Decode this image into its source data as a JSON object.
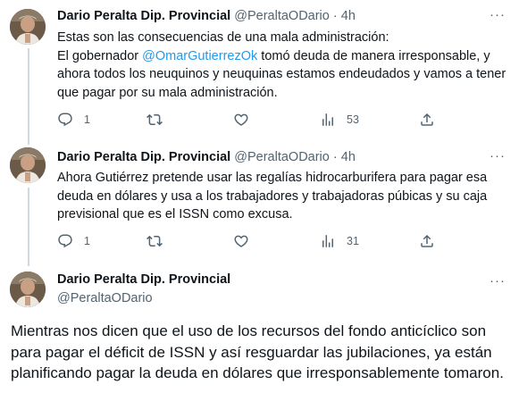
{
  "tweets": [
    {
      "author_name": "Dario Peralta Dip. Provincial",
      "author_handle": "@PeraltaODario",
      "separator": "·",
      "time": "4h",
      "text_line1": "Estas son las consecuencias de una mala administración:",
      "text_pre_mention": "El gobernador ",
      "mention": "@OmarGutierrezOk",
      "text_post_mention": " tomó deuda de manera irresponsable, y ahora todos los neuquinos y neuquinas estamos endeudados y vamos a tener que pagar por su mala administración.",
      "replies": "1",
      "retweets": "",
      "likes": "",
      "views": "53"
    },
    {
      "author_name": "Dario Peralta Dip. Provincial",
      "author_handle": "@PeraltaODario",
      "separator": "·",
      "time": "4h",
      "text": "Ahora Gutiérrez pretende usar las regalías hidrocarburifera para pagar esa deuda en dólares y usa a los trabajadores y trabajadoras púbicas y su caja previsional que es el ISSN como excusa.",
      "replies": "1",
      "retweets": "",
      "likes": "",
      "views": "31"
    }
  ],
  "main_tweet": {
    "author_name": "Dario Peralta Dip. Provincial",
    "author_handle": "@PeraltaODario",
    "text": "Mientras nos dicen que el uso de los recursos del fondo anticíclico son para pagar el déficit de ISSN y así resguardar las jubilaciones, ya están planificando pagar la deuda en dólares que irresponsablemente tomaron."
  },
  "icons": {
    "more": "more-horizontal-icon",
    "reply": "reply-bubble-icon",
    "retweet": "retweet-icon",
    "like": "heart-icon",
    "views": "bar-chart-icon",
    "share": "share-upload-icon"
  },
  "colors": {
    "accent": "#1d9bf0",
    "secondary_text": "#536471",
    "thread_line": "#cfd9de"
  }
}
